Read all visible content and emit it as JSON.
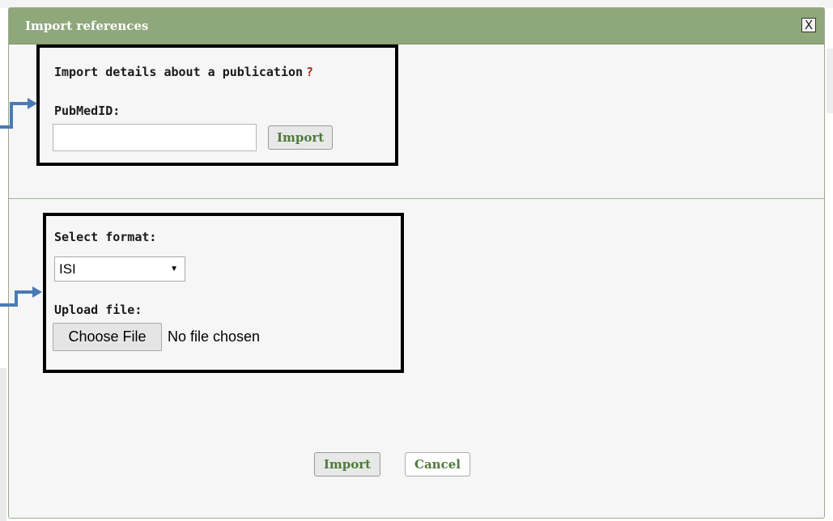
{
  "dialog": {
    "title": "Import references",
    "close_label": "X"
  },
  "pubmed_section": {
    "heading": "Import details about a publication",
    "help_mark": "?",
    "id_label": "PubMedID:",
    "id_value": "",
    "import_label": "Import"
  },
  "file_section": {
    "format_label": "Select format:",
    "format_selected": "ISI",
    "upload_label": "Upload file:",
    "choose_label": "Choose File",
    "file_status": "No file chosen"
  },
  "footer": {
    "import_label": "Import",
    "cancel_label": "Cancel"
  },
  "colors": {
    "titlebar": "#8fa87b",
    "accent_text": "#4e7a3c",
    "annotation_arrow": "#4a7ab5"
  }
}
